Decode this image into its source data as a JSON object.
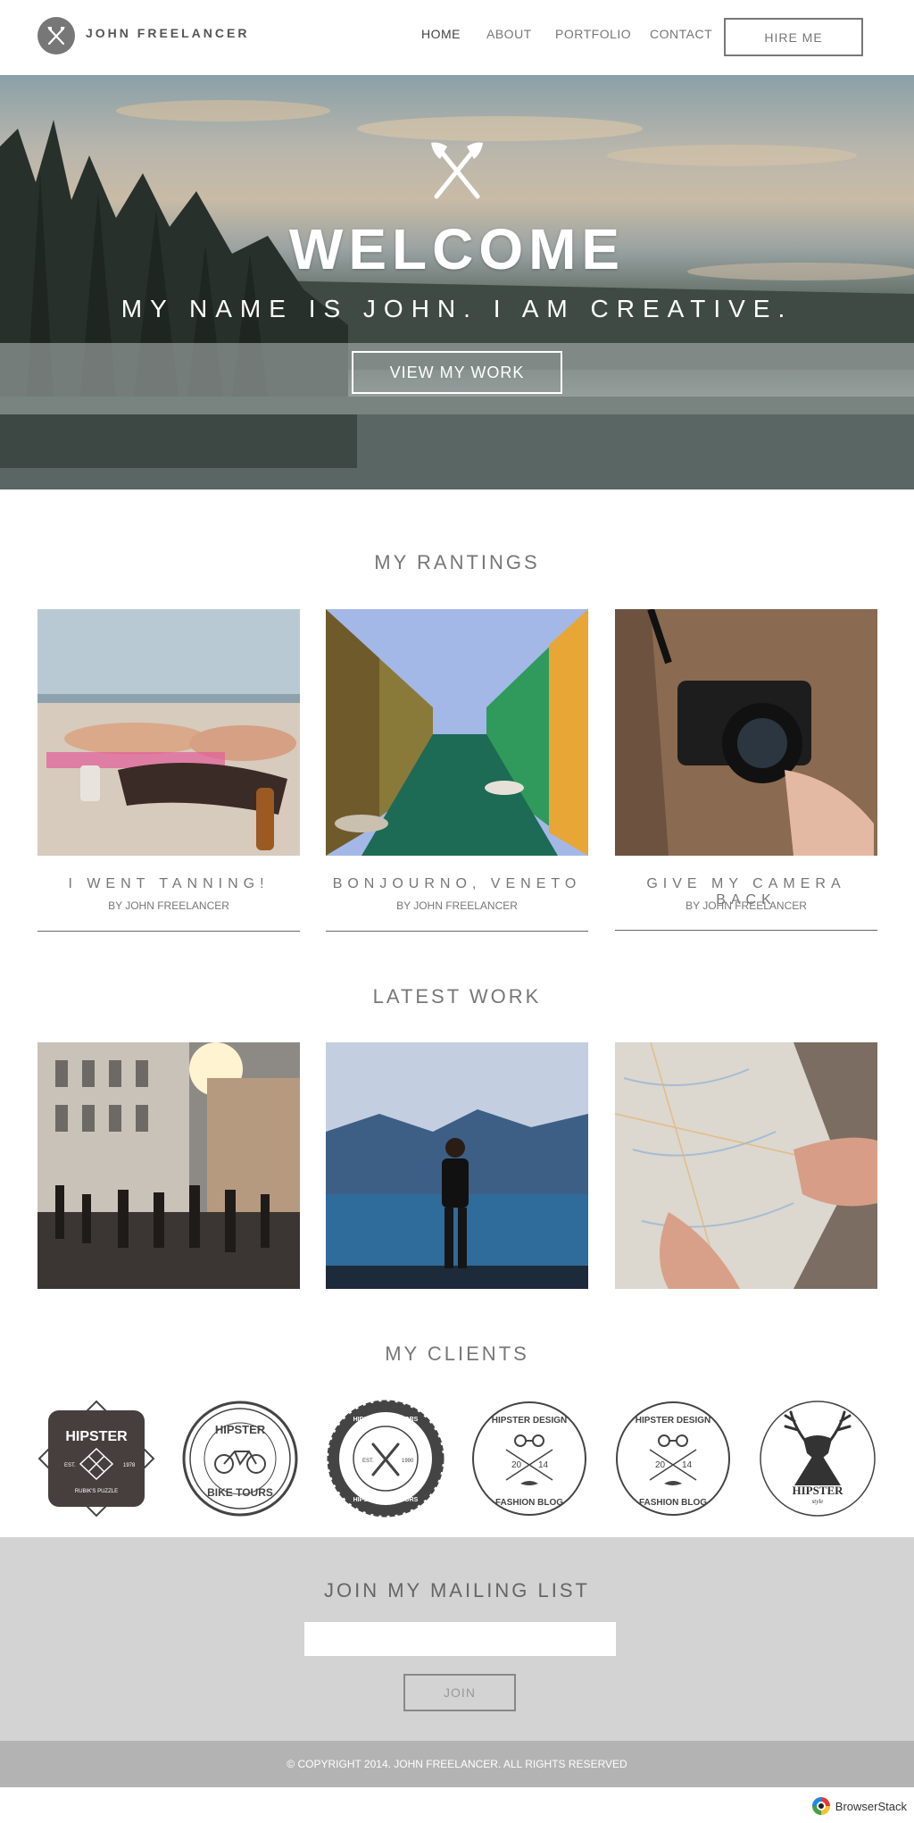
{
  "nav": {
    "brand": "JOHN FREELANCER",
    "items": [
      {
        "label": "HOME",
        "active": true
      },
      {
        "label": "ABOUT",
        "active": false
      },
      {
        "label": "PORTFOLIO",
        "active": false
      },
      {
        "label": "CONTACT",
        "active": false
      }
    ],
    "hire_label": "HIRE ME"
  },
  "hero": {
    "title": "WELCOME",
    "subtitle": "MY NAME IS JOHN. I AM CREATIVE.",
    "button_label": "VIEW MY WORK",
    "icon": "crossed-axes-icon"
  },
  "rantings": {
    "title": "MY RANTINGS",
    "posts": [
      {
        "title": "I WENT TANNING!",
        "byline": "BY JOHN FREELANCER",
        "image": "beach-photo"
      },
      {
        "title": "BONJOURNO, VENETO",
        "byline": "BY JOHN FREELANCER",
        "image": "canal-photo"
      },
      {
        "title": "GIVE MY CAMERA BACK",
        "byline": "BY JOHN FREELANCER",
        "image": "camera-photo"
      }
    ]
  },
  "work": {
    "title": "LATEST WORK",
    "items": [
      {
        "image": "city-street-photo"
      },
      {
        "image": "lake-man-photo"
      },
      {
        "image": "map-photo"
      }
    ]
  },
  "clients": {
    "title": "MY CLIENTS",
    "logos": [
      {
        "name": "hipster-rubiks-logo",
        "line1": "HIPSTER",
        "line2": "RUBIK'S PUZZLE",
        "est": "EST.",
        "year": "1978"
      },
      {
        "name": "hipster-bike-tours-logo",
        "line1": "HIPSTER",
        "line2": "BIKE TOURS"
      },
      {
        "name": "hipster-outdoors-logo",
        "line1": "HIPSTER OUTDOORS",
        "line2": "HIPSTER OUTDOORS",
        "est": "EST.",
        "year": "1990"
      },
      {
        "name": "hipster-design-fashion-blog-logo-1",
        "line1": "HIPSTER DESIGN",
        "line2": "FASHION BLOG",
        "num1": "20",
        "num2": "14"
      },
      {
        "name": "hipster-design-fashion-blog-logo-2",
        "line1": "HIPSTER DESIGN",
        "line2": "FASHION BLOG",
        "num1": "20",
        "num2": "14"
      },
      {
        "name": "hipster-style-logo",
        "line1": "HIPSTER",
        "line2": "style"
      }
    ]
  },
  "mailing": {
    "title": "JOIN MY MAILING LIST",
    "input_value": "",
    "button_label": "JOIN"
  },
  "footer": {
    "copyright": "© COPYRIGHT 2014. JOHN FREELANCER. ALL RIGHTS RESERVED"
  },
  "badge": {
    "label": "BrowserStack"
  }
}
